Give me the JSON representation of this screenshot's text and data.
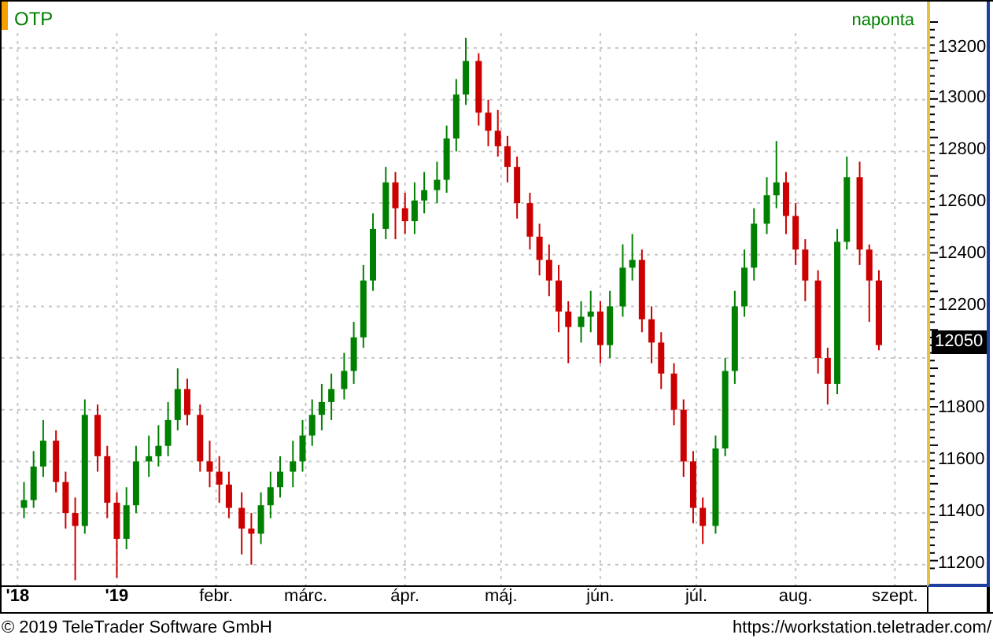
{
  "chart": {
    "symbol": "OTP",
    "interval": "naponta",
    "current_price": "12050",
    "chart_data": {
      "type": "candlestick",
      "xlim": [
        "2018-11-26",
        "2019-09-11"
      ],
      "ylim": [
        11120,
        13380
      ],
      "grid": true,
      "yticks": [
        11200,
        11400,
        11600,
        11800,
        12200,
        12400,
        12600,
        12800,
        13000,
        13200
      ],
      "xticks": [
        {
          "value": "2018-12-01",
          "label": "'18"
        },
        {
          "value": "2019-01-01",
          "label": "'19"
        },
        {
          "value": "2019-02-01",
          "label": "febr."
        },
        {
          "value": "2019-03-01",
          "label": "márc."
        },
        {
          "value": "2019-04-01",
          "label": "ápr."
        },
        {
          "value": "2019-05-01",
          "label": "máj."
        },
        {
          "value": "2019-06-01",
          "label": "jún."
        },
        {
          "value": "2019-07-01",
          "label": "júl."
        },
        {
          "value": "2019-08-01",
          "label": "aug."
        },
        {
          "value": "2019-09-01",
          "label": "szept."
        }
      ],
      "x": [
        "2018-12-03",
        "2018-12-06",
        "2018-12-09",
        "2018-12-13",
        "2018-12-16",
        "2018-12-19",
        "2018-12-22",
        "2018-12-26",
        "2018-12-29",
        "2019-01-01",
        "2019-01-04",
        "2019-01-07",
        "2019-01-11",
        "2019-01-14",
        "2019-01-17",
        "2019-01-20",
        "2019-01-23",
        "2019-01-27",
        "2019-01-30",
        "2019-02-02",
        "2019-02-05",
        "2019-02-09",
        "2019-02-12",
        "2019-02-15",
        "2019-02-18",
        "2019-02-21",
        "2019-02-25",
        "2019-02-28",
        "2019-03-03",
        "2019-03-06",
        "2019-03-09",
        "2019-03-13",
        "2019-03-16",
        "2019-03-19",
        "2019-03-22",
        "2019-03-26",
        "2019-03-29",
        "2019-04-01",
        "2019-04-04",
        "2019-04-07",
        "2019-04-11",
        "2019-04-14",
        "2019-04-17",
        "2019-04-20",
        "2019-04-24",
        "2019-04-27",
        "2019-04-30",
        "2019-05-03",
        "2019-05-06",
        "2019-05-10",
        "2019-05-13",
        "2019-05-16",
        "2019-05-19",
        "2019-05-22",
        "2019-05-26",
        "2019-05-29",
        "2019-06-01",
        "2019-06-04",
        "2019-06-08",
        "2019-06-11",
        "2019-06-14",
        "2019-06-17",
        "2019-06-20",
        "2019-06-24",
        "2019-06-27",
        "2019-06-30",
        "2019-07-03",
        "2019-07-07",
        "2019-07-10",
        "2019-07-13",
        "2019-07-16",
        "2019-07-19",
        "2019-07-23",
        "2019-07-26",
        "2019-07-29",
        "2019-08-01",
        "2019-08-04",
        "2019-08-08",
        "2019-08-11",
        "2019-08-14",
        "2019-08-17",
        "2019-08-21",
        "2019-08-24",
        "2019-08-27"
      ],
      "ohlc": [
        [
          11420,
          11520,
          11380,
          11450
        ],
        [
          11450,
          11640,
          11420,
          11580
        ],
        [
          11580,
          11760,
          11540,
          11680
        ],
        [
          11680,
          11720,
          11480,
          11520
        ],
        [
          11520,
          11560,
          11340,
          11400
        ],
        [
          11400,
          11460,
          11140,
          11350
        ],
        [
          11350,
          11840,
          11320,
          11780
        ],
        [
          11780,
          11820,
          11560,
          11620
        ],
        [
          11620,
          11660,
          11380,
          11440
        ],
        [
          11440,
          11480,
          11150,
          11300
        ],
        [
          11300,
          11500,
          11260,
          11430
        ],
        [
          11430,
          11660,
          11400,
          11600
        ],
        [
          11600,
          11700,
          11540,
          11620
        ],
        [
          11620,
          11740,
          11580,
          11660
        ],
        [
          11660,
          11830,
          11620,
          11760
        ],
        [
          11760,
          11960,
          11720,
          11880
        ],
        [
          11880,
          11920,
          11740,
          11780
        ],
        [
          11780,
          11820,
          11560,
          11600
        ],
        [
          11600,
          11680,
          11500,
          11560
        ],
        [
          11560,
          11620,
          11440,
          11510
        ],
        [
          11510,
          11560,
          11380,
          11420
        ],
        [
          11420,
          11480,
          11240,
          11340
        ],
        [
          11340,
          11400,
          11200,
          11320
        ],
        [
          11320,
          11480,
          11280,
          11430
        ],
        [
          11430,
          11560,
          11380,
          11500
        ],
        [
          11500,
          11620,
          11460,
          11560
        ],
        [
          11560,
          11680,
          11500,
          11600
        ],
        [
          11600,
          11760,
          11560,
          11700
        ],
        [
          11700,
          11840,
          11660,
          11780
        ],
        [
          11780,
          11900,
          11720,
          11830
        ],
        [
          11830,
          11940,
          11760,
          11880
        ],
        [
          11880,
          12020,
          11840,
          11950
        ],
        [
          11950,
          12140,
          11900,
          12080
        ],
        [
          12080,
          12360,
          12040,
          12300
        ],
        [
          12300,
          12560,
          12260,
          12500
        ],
        [
          12500,
          12740,
          12460,
          12680
        ],
        [
          12680,
          12720,
          12460,
          12580
        ],
        [
          12580,
          12640,
          12480,
          12530
        ],
        [
          12530,
          12680,
          12480,
          12610
        ],
        [
          12610,
          12720,
          12560,
          12650
        ],
        [
          12650,
          12760,
          12600,
          12690
        ],
        [
          12690,
          12900,
          12640,
          12850
        ],
        [
          12850,
          13080,
          12800,
          13020
        ],
        [
          13020,
          13240,
          12980,
          13150
        ],
        [
          13150,
          13180,
          12900,
          12950
        ],
        [
          12950,
          13000,
          12820,
          12880
        ],
        [
          12880,
          12960,
          12780,
          12820
        ],
        [
          12820,
          12860,
          12680,
          12740
        ],
        [
          12740,
          12780,
          12540,
          12600
        ],
        [
          12600,
          12640,
          12420,
          12470
        ],
        [
          12470,
          12520,
          12320,
          12380
        ],
        [
          12380,
          12440,
          12240,
          12300
        ],
        [
          12300,
          12360,
          12100,
          12180
        ],
        [
          12180,
          12220,
          11980,
          12120
        ],
        [
          12120,
          12220,
          12060,
          12160
        ],
        [
          12160,
          12260,
          12100,
          12180
        ],
        [
          12180,
          12220,
          11980,
          12050
        ],
        [
          12050,
          12260,
          12000,
          12200
        ],
        [
          12200,
          12440,
          12160,
          12350
        ],
        [
          12350,
          12480,
          12300,
          12380
        ],
        [
          12380,
          12420,
          12100,
          12150
        ],
        [
          12150,
          12200,
          11980,
          12060
        ],
        [
          12060,
          12100,
          11880,
          11940
        ],
        [
          11940,
          11980,
          11740,
          11800
        ],
        [
          11800,
          11840,
          11540,
          11600
        ],
        [
          11600,
          11640,
          11360,
          11420
        ],
        [
          11420,
          11460,
          11280,
          11350
        ],
        [
          11350,
          11700,
          11320,
          11650
        ],
        [
          11650,
          12000,
          11620,
          11950
        ],
        [
          11950,
          12260,
          11900,
          12200
        ],
        [
          12200,
          12420,
          12160,
          12350
        ],
        [
          12350,
          12580,
          12300,
          12520
        ],
        [
          12520,
          12700,
          12480,
          12630
        ],
        [
          12630,
          12840,
          12580,
          12680
        ],
        [
          12680,
          12720,
          12480,
          12550
        ],
        [
          12550,
          12600,
          12360,
          12420
        ],
        [
          12420,
          12460,
          12220,
          12300
        ],
        [
          12300,
          12340,
          11940,
          12000
        ],
        [
          12000,
          12040,
          11820,
          11900
        ],
        [
          11900,
          12500,
          11860,
          12450
        ],
        [
          12450,
          12780,
          12420,
          12700
        ],
        [
          12700,
          12760,
          12360,
          12420
        ],
        [
          12420,
          12440,
          12140,
          12300
        ],
        [
          12300,
          12340,
          12030,
          12050
        ]
      ]
    },
    "xtick_bold": [
      true,
      true,
      false,
      false,
      false,
      false,
      false,
      false,
      false,
      false
    ]
  },
  "footer": {
    "copyright": "© 2019 TeleTrader Software GmbH",
    "url": "https://workstation.teletrader.com/"
  }
}
